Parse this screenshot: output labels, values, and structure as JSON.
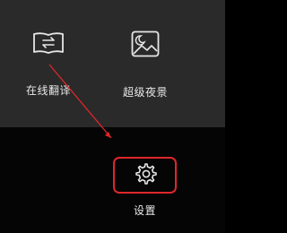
{
  "tiles": {
    "translate": {
      "label": "在线翻译",
      "icon": "translate-book-icon"
    },
    "night": {
      "label": "超级夜景",
      "icon": "night-scene-icon"
    }
  },
  "settings": {
    "label": "设置",
    "icon": "gear-icon"
  },
  "annotation": {
    "color": "#e0262a",
    "highlight_target": "settings"
  },
  "colors": {
    "panel": "#2a2a2a",
    "background": "#050505",
    "text": "#e8e8e8"
  }
}
